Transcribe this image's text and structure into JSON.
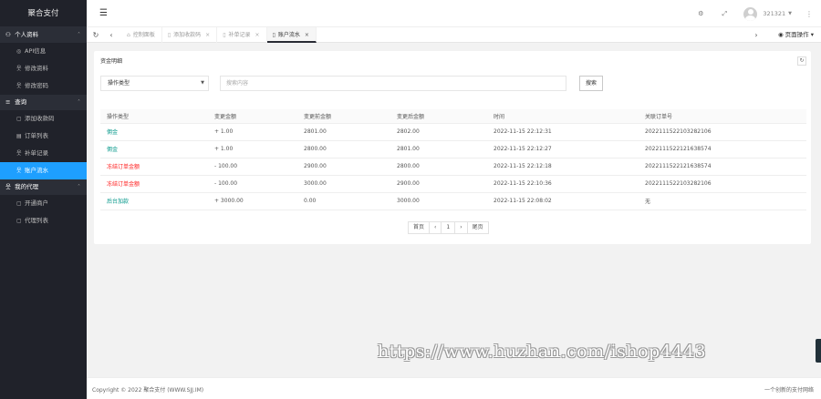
{
  "app": {
    "logo_text": "聚合支付"
  },
  "sidebar": {
    "groups": [
      {
        "label": "个人资料",
        "items": [
          "API信息",
          "修改资料",
          "修改密码"
        ]
      },
      {
        "label": "查询",
        "items": [
          "添加收款码",
          "订单列表",
          "补单记录",
          "账户流水"
        ]
      },
      {
        "label": "我的代理",
        "items": [
          "开通商户",
          "代理列表"
        ]
      }
    ],
    "active_item": "账户流水"
  },
  "header": {
    "menu_icon": "hamburger-icon",
    "username": "321321"
  },
  "tabs": [
    {
      "label": "控制面板",
      "icon": "home-icon",
      "active": false
    },
    {
      "label": "添加收款码",
      "icon": "doc-icon",
      "active": false
    },
    {
      "label": "补单记录",
      "icon": "doc-icon",
      "active": false
    },
    {
      "label": "账户流水",
      "icon": "doc-icon",
      "active": true
    }
  ],
  "page_ops_label": "页面操作",
  "card": {
    "title": "资金明细",
    "select_value": "操作类型",
    "search_placeholder": "搜索内容",
    "search_button": "搜索"
  },
  "table": {
    "columns": [
      "操作类型",
      "变更金额",
      "变更前金额",
      "变更后金额",
      "时间",
      "关联订单号"
    ],
    "rows": [
      {
        "type": "佣金",
        "color": "green",
        "amount": "+ 1.00",
        "before": "2801.00",
        "after": "2802.00",
        "time": "2022-11-15 22:12:31",
        "order": "2022111522103282106"
      },
      {
        "type": "佣金",
        "color": "green",
        "amount": "+ 1.00",
        "before": "2800.00",
        "after": "2801.00",
        "time": "2022-11-15 22:12:27",
        "order": "2022111522121638574"
      },
      {
        "type": "冻结订单金额",
        "color": "red",
        "amount": "- 100.00",
        "before": "2900.00",
        "after": "2800.00",
        "time": "2022-11-15 22:12:18",
        "order": "2022111522121638574"
      },
      {
        "type": "冻结订单金额",
        "color": "red",
        "amount": "- 100.00",
        "before": "3000.00",
        "after": "2900.00",
        "time": "2022-11-15 22:10:36",
        "order": "2022111522103282106"
      },
      {
        "type": "后台加款",
        "color": "green",
        "amount": "+ 3000.00",
        "before": "0.00",
        "after": "3000.00",
        "time": "2022-11-15 22:08:02",
        "order": "无"
      }
    ]
  },
  "pagination": {
    "first": "首页",
    "prev": "‹",
    "current": "1",
    "next": "›",
    "last": "尾页"
  },
  "watermark": "https://www.huzhan.com/ishop4443",
  "footer": {
    "copyright": "Copyright © 2022 聚合支付    (WWW.SJJ.IM)",
    "slogan": "一个创新的支付网络"
  },
  "colors": {
    "sidebar_bg": "#20222a",
    "active": "#1e9fff",
    "green": "#009688",
    "red": "#ff2020"
  }
}
